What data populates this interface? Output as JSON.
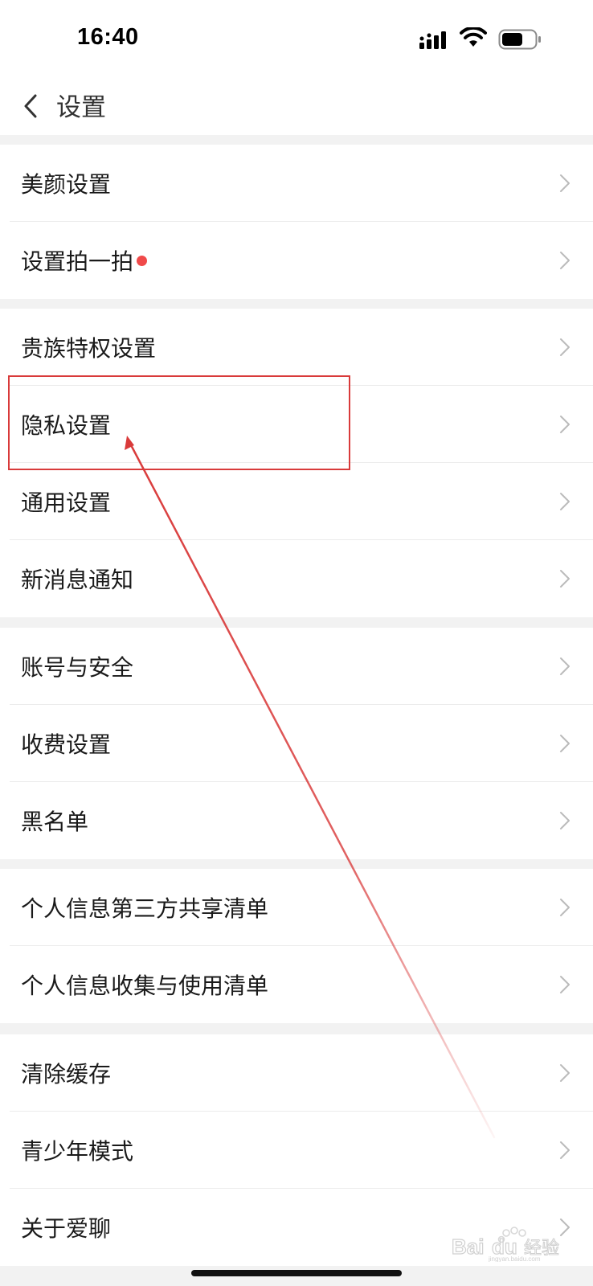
{
  "status_bar": {
    "time": "16:40"
  },
  "header": {
    "title": "设置",
    "back_icon": "chevron-left-icon"
  },
  "groups": [
    {
      "items": [
        {
          "label": "美颜设置",
          "badge_dot": false
        },
        {
          "label": "设置拍一拍",
          "badge_dot": true
        }
      ]
    },
    {
      "items": [
        {
          "label": "贵族特权设置",
          "badge_dot": false
        },
        {
          "label": "隐私设置",
          "badge_dot": false
        },
        {
          "label": "通用设置",
          "badge_dot": false
        },
        {
          "label": "新消息通知",
          "badge_dot": false
        }
      ]
    },
    {
      "items": [
        {
          "label": "账号与安全",
          "badge_dot": false
        },
        {
          "label": "收费设置",
          "badge_dot": false
        },
        {
          "label": "黑名单",
          "badge_dot": false
        }
      ]
    },
    {
      "items": [
        {
          "label": "个人信息第三方共享清单",
          "badge_dot": false
        },
        {
          "label": "个人信息收集与使用清单",
          "badge_dot": false
        }
      ]
    },
    {
      "items": [
        {
          "label": "清除缓存",
          "badge_dot": false
        },
        {
          "label": "青少年模式",
          "badge_dot": false
        },
        {
          "label": "关于爱聊",
          "badge_dot": false
        }
      ]
    }
  ],
  "colors": {
    "badge": "#f04a4a",
    "annotation": "#d93a3a",
    "background": "#f2f2f2"
  },
  "watermark": {
    "text": "Baidu经验",
    "sub": "jingyan.baidu.com"
  }
}
